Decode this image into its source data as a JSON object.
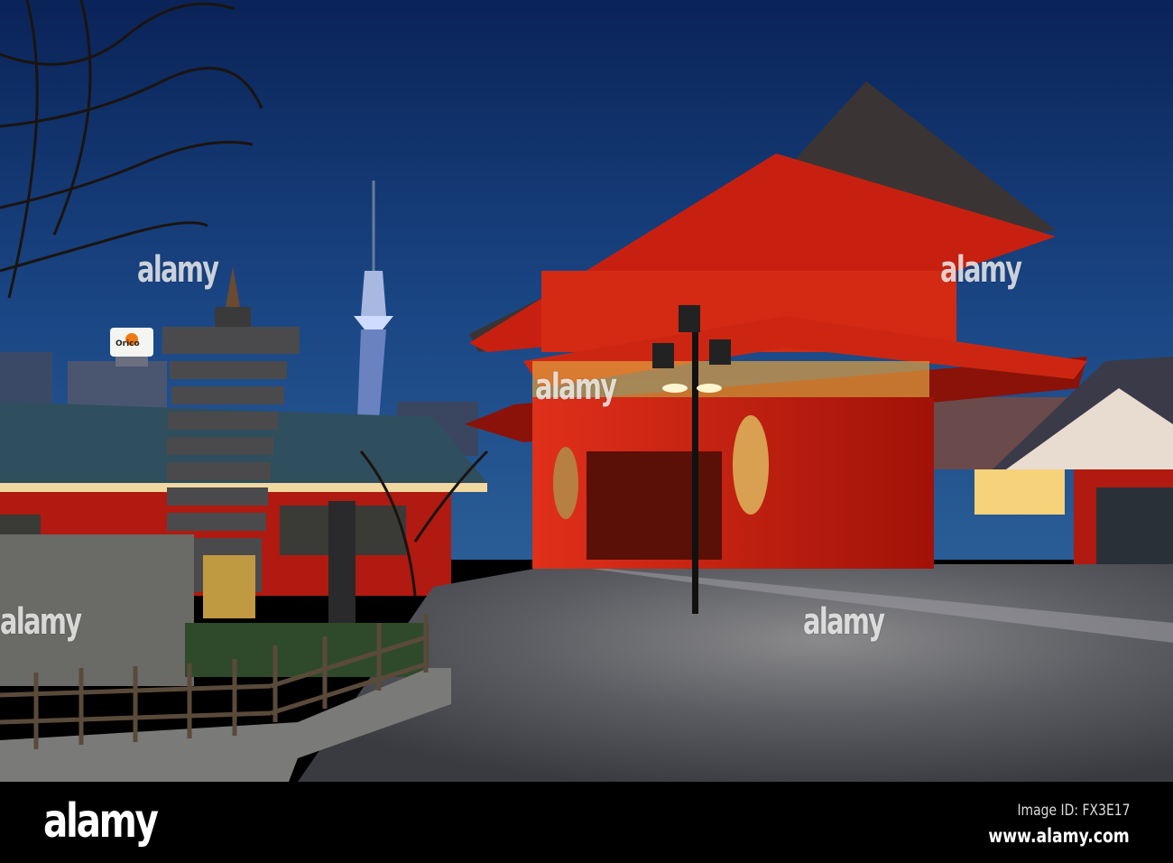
{
  "photo": {
    "watermark": "alamy",
    "sign_text": "Orico"
  },
  "footer": {
    "logo": "alamy",
    "image_id": "Image ID: FX3E17",
    "website": "www.alamy.com"
  },
  "colors": {
    "sky_top": "#0a2358",
    "sky_horizon": "#1f5390",
    "gate_red": "#c21a0c",
    "ground": "#55565b"
  }
}
